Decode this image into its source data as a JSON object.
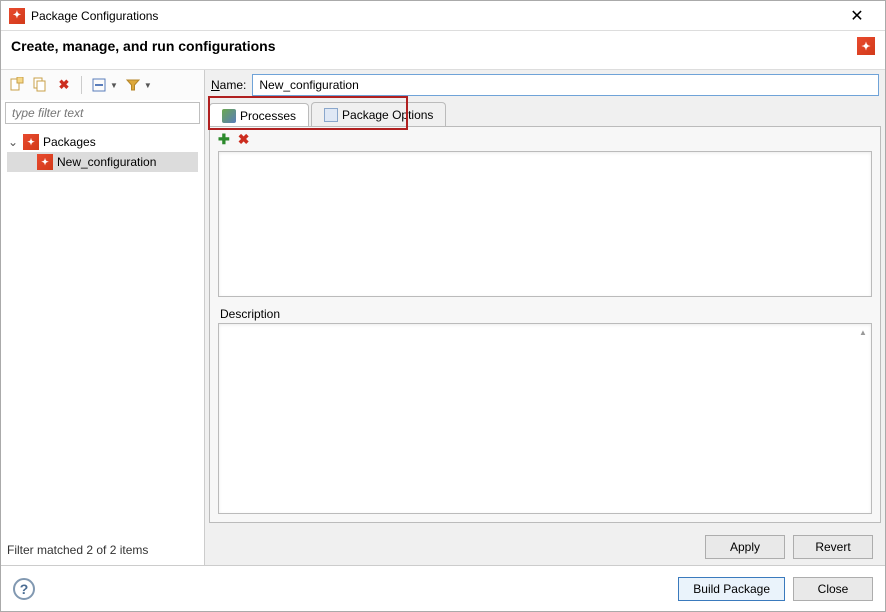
{
  "window": {
    "title": "Package Configurations",
    "heading": "Create, manage, and run configurations"
  },
  "toolbar": {
    "new": "",
    "copy": "",
    "delete": "",
    "collapse": "",
    "filter": ""
  },
  "filter_placeholder": "type filter text",
  "tree": {
    "root_label": "Packages",
    "items": [
      {
        "label": "New_configuration",
        "selected": true
      }
    ]
  },
  "left_footer": "Filter matched 2 of 2 items",
  "name": {
    "label": "Name:",
    "underline_index": 0,
    "value": "New_configuration"
  },
  "tabs": [
    {
      "id": "processes",
      "label": "Processes",
      "active": true
    },
    {
      "id": "package_options",
      "label": "Package Options",
      "active": false
    }
  ],
  "processes": {
    "description_label": "Description"
  },
  "buttons": {
    "apply": "Apply",
    "revert": "Revert",
    "build": "Build Package",
    "close": "Close"
  }
}
